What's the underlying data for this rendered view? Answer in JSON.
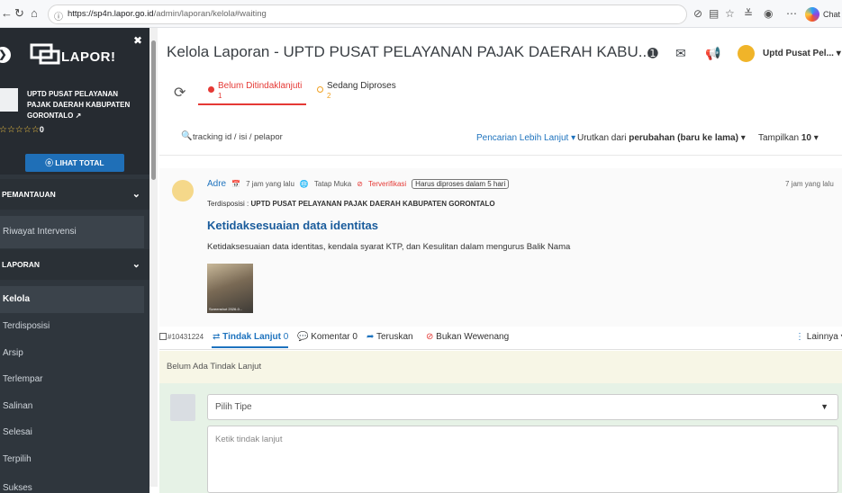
{
  "browser": {
    "url_host": "https://sp4n.lapor.go.id",
    "url_path": "/admin/laporan/kelola#waiting",
    "chat_label": "Chat"
  },
  "sidebar": {
    "logo_text": "LAPOR!",
    "institution_name": "UPTD PUSAT PELAYANAN PAJAK DAERAH KABUPATEN GORONTALO",
    "rating_stars": "☆☆☆☆☆",
    "rating_value": "0",
    "view_total_label": "LIHAT TOTAL",
    "sections": [
      {
        "label": "PEMANTAUAN",
        "items": [
          "Riwayat Intervensi"
        ]
      },
      {
        "label": "LAPORAN",
        "items": [
          "Kelola",
          "Terdisposisi",
          "Arsip",
          "Terlempar",
          "Salinan",
          "Selesai",
          "Terpilih",
          "Sukses"
        ]
      }
    ]
  },
  "header": {
    "title": "Kelola Laporan - UPTD PUSAT PELAYANAN PAJAK DAERAH KABU...",
    "user_name": "Uptd Pusat Pel..."
  },
  "tabs": [
    {
      "label": "Belum Ditindaklanjuti",
      "count": "1",
      "color": "#e53935"
    },
    {
      "label": "Sedang Diproses",
      "count": "2",
      "color": "#f0a020"
    }
  ],
  "filters": {
    "search_placeholder": "tracking id / isi / pelapor",
    "advanced_search": "Pencarian Lebih Lanjut",
    "sort_prefix": "Urutkan dari",
    "sort_value": "perubahan (baru ke lama)",
    "show_prefix": "Tampilkan",
    "show_value": "10"
  },
  "report": {
    "reporter": "Adre",
    "time": "7 jam yang lalu",
    "channel": "Tatap Muka",
    "status": "Terverifikasi",
    "deadline": "Harus diproses dalam 5 hari",
    "time_right": "7 jam yang lalu",
    "dispo_label": "Terdisposisi :",
    "dispo_value": "UPTD PUSAT PELAYANAN PAJAK DAERAH KABUPATEN GORONTALO",
    "title": "Ketidaksesuaian data identitas",
    "body": "Ketidaksesuaian data identitas, kendala syarat KTP, dan Kesulitan dalam mengurus Balik Nama",
    "attachment_caption": "Screenshot 2026-0..."
  },
  "actions": {
    "ticket_id": "#10431224",
    "follow_up_label": "Tindak Lanjut",
    "follow_up_count": "0",
    "comment_label": "Komentar",
    "comment_count": "0",
    "forward_label": "Teruskan",
    "not_authority_label": "Bukan Wewenang",
    "more_label": "Lainnya"
  },
  "followup_form": {
    "notice": "Belum Ada Tindak Lanjut",
    "type_placeholder": "Pilih Tipe",
    "text_placeholder": "Ketik tindak lanjut"
  }
}
